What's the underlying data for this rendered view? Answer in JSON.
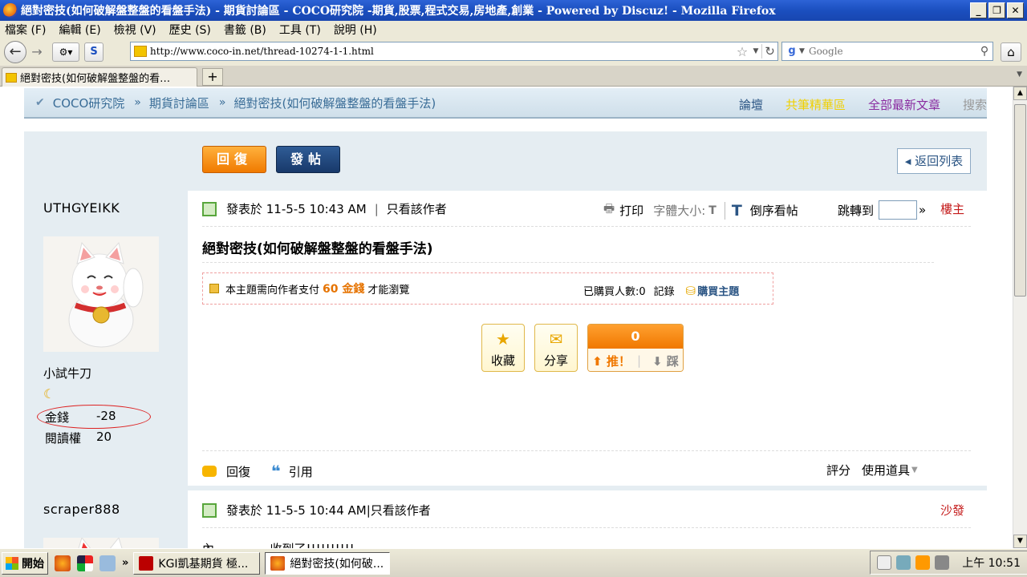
{
  "window": {
    "title": "絕對密技(如何破解盤整盤的看盤手法) - 期貨討論區 - COCO研究院 -期貨,股票,程式交易,房地產,創業 - Powered by Discuz! - Mozilla Firefox",
    "minimize": "_",
    "maximize": "❐",
    "close": "✕"
  },
  "menu": [
    "檔案 (F)",
    "編輯 (E)",
    "檢視 (V)",
    "歷史 (S)",
    "書籤 (B)",
    "工具 (T)",
    "說明 (H)"
  ],
  "nav": {
    "url": "http://www.coco-in.net/thread-10274-1-1.html",
    "search_placeholder": "Google"
  },
  "tabs": [
    {
      "label": "絕對密技(如何破解盤整盤的看…"
    }
  ],
  "forum_nav": {
    "crumbs": [
      "COCO研究院",
      "期貨討論區",
      "絕對密技(如何破解盤整盤的看盤手法)"
    ],
    "links": [
      {
        "label": "論壇",
        "color": "#2b5584"
      },
      {
        "label": "共筆精華區",
        "color": "#f0d000"
      },
      {
        "label": "全部最新文章",
        "color": "#8a2ba0"
      },
      {
        "label": "搜索",
        "color": "#999999"
      }
    ]
  },
  "toolbar": {
    "reply": "回復",
    "post": "發帖",
    "back_to_list": "返回列表"
  },
  "post1": {
    "author": "UTHGYEIKK",
    "rank": "小試牛刀",
    "money_label": "金錢",
    "money_value": "-28",
    "read_label": "閱讀權",
    "read_value": "20",
    "posted": "發表於 11-5-5 10:43 AM",
    "only_author": "只看該作者",
    "print": "打印",
    "font_size": "字體大小:",
    "reverse": "倒序看帖",
    "jump_to": "跳轉到",
    "floor": "樓主",
    "title": "絕對密技(如何破解盤整盤的看盤手法)",
    "pay_prefix": "本主題需向作者支付",
    "pay_amount": "60 金錢",
    "pay_suffix": "才能瀏覽",
    "buyers": "已購買人數:0",
    "record": "記錄",
    "buy_topic": "購買主題",
    "favorite": "收藏",
    "share": "分享",
    "vote_count": "0",
    "vote_up": "推！",
    "vote_down": "踩",
    "reply": "回復",
    "quote": "引用",
    "rate": "評分",
    "use_tools": "使用道具"
  },
  "post2": {
    "author": "scraper888",
    "posted": "發表於 11-5-5 10:44 AM",
    "only_author": "只看該作者",
    "floor": "沙發",
    "text": "內 ………… 收到了!!!!!!!!!!"
  },
  "taskbar": {
    "start": "開始",
    "tasks": [
      {
        "label": "KGI凱基期貨 極...",
        "active": false
      },
      {
        "label": "絕對密技(如何破...",
        "active": true
      }
    ],
    "clock": "上午 10:51"
  }
}
